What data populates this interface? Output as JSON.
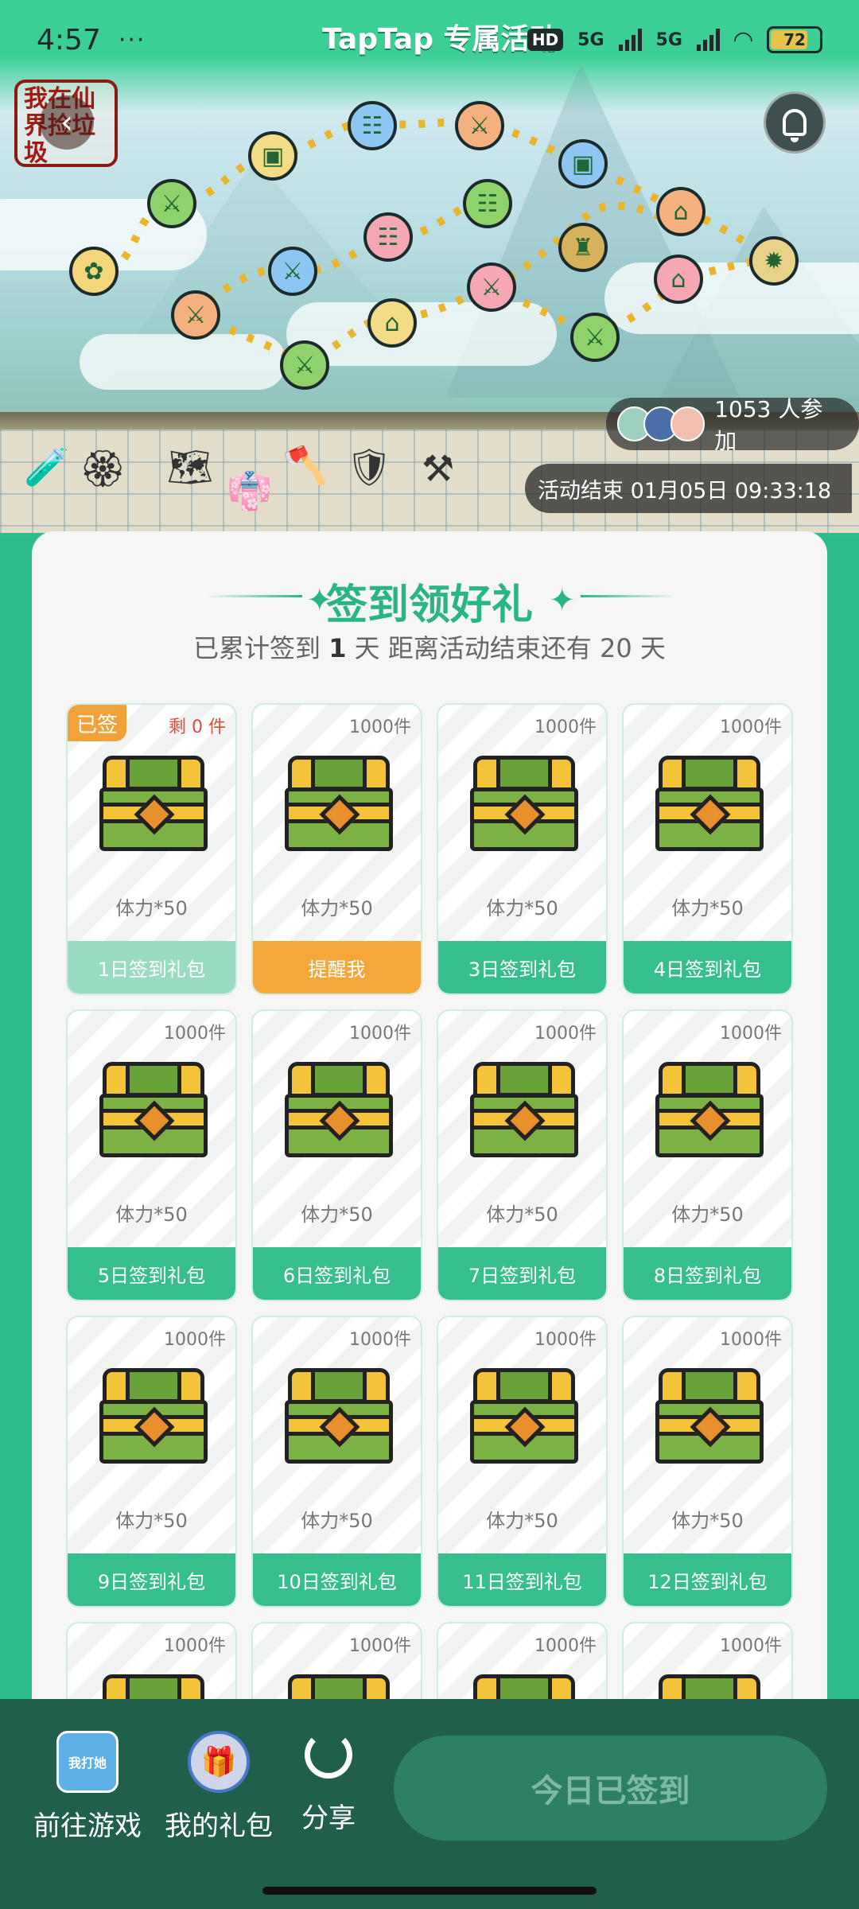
{
  "status_bar": {
    "time": "4:57",
    "dots": "···",
    "title": "TapTap 专属活动",
    "hd": "HD",
    "net1": "5G",
    "net2": "5G",
    "battery": "72"
  },
  "hero": {
    "logo_text": "我在仙界捡垃圾",
    "participants": "1053 人参加",
    "end_time": "活动结束 01月05日 09:33:18"
  },
  "card": {
    "title": "签到领好礼",
    "sub_prefix": "已累计签到",
    "sub_days": "1",
    "sub_mid": "天  距离活动结束还有",
    "sub_remaining": "20",
    "sub_suffix": "天"
  },
  "gifts": [
    {
      "stock": "剩 0 件",
      "tag": "已签",
      "name": "体力*50",
      "button": "1日签到礼包"
    },
    {
      "stock": "1000件",
      "name": "体力*50",
      "button": "提醒我"
    },
    {
      "stock": "1000件",
      "name": "体力*50",
      "button": "3日签到礼包"
    },
    {
      "stock": "1000件",
      "name": "体力*50",
      "button": "4日签到礼包"
    },
    {
      "stock": "1000件",
      "name": "体力*50",
      "button": "5日签到礼包"
    },
    {
      "stock": "1000件",
      "name": "体力*50",
      "button": "6日签到礼包"
    },
    {
      "stock": "1000件",
      "name": "体力*50",
      "button": "7日签到礼包"
    },
    {
      "stock": "1000件",
      "name": "体力*50",
      "button": "8日签到礼包"
    },
    {
      "stock": "1000件",
      "name": "体力*50",
      "button": "9日签到礼包"
    },
    {
      "stock": "1000件",
      "name": "体力*50",
      "button": "10日签到礼包"
    },
    {
      "stock": "1000件",
      "name": "体力*50",
      "button": "11日签到礼包"
    },
    {
      "stock": "1000件",
      "name": "体力*50",
      "button": "12日签到礼包"
    },
    {
      "stock": "1000件"
    },
    {
      "stock": "1000件"
    },
    {
      "stock": "1000件"
    },
    {
      "stock": "1000件"
    }
  ],
  "bottom_bar": {
    "game_label": "前往游戏",
    "game_icon_text": "我打她",
    "gifts_label": "我的礼包",
    "share_label": "分享",
    "checkin_label": "今日已签到"
  },
  "colors": {
    "brand_green": "#2ab684",
    "remind_orange": "#f5a73a",
    "bottom_bar": "#1f5f4c"
  }
}
